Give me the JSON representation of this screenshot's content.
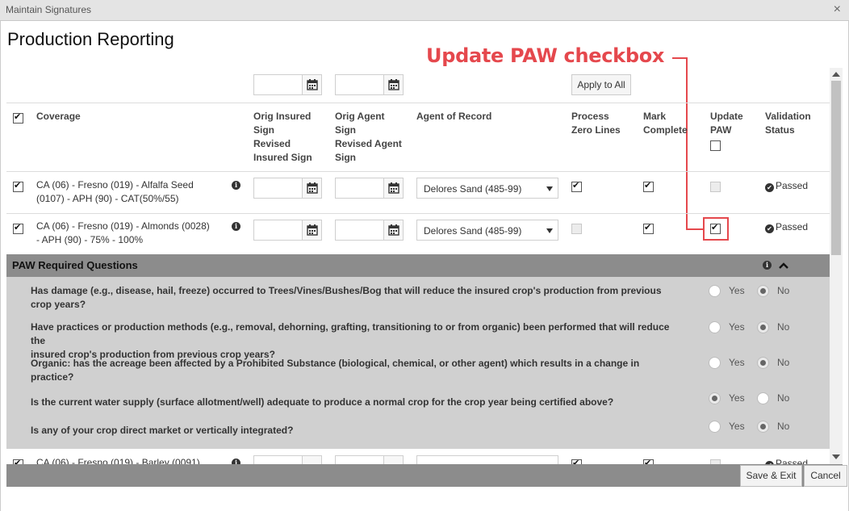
{
  "window": {
    "title": "Maintain Signatures",
    "close_glyph": "×"
  },
  "page_title": "Production Reporting",
  "annotation": {
    "text": "Update PAW checkbox",
    "color": "#e5484d"
  },
  "toolbar": {
    "apply_label": "Apply to All"
  },
  "columns": {
    "coverage": "Coverage",
    "orig_insured": [
      "Orig Insured",
      "Sign",
      "Revised",
      "Insured Sign"
    ],
    "orig_agent": [
      "Orig Agent",
      "Sign",
      "Revised Agent",
      "Sign"
    ],
    "agent_of_record": "Agent of Record",
    "process_zero": [
      "Process",
      "Zero Lines"
    ],
    "mark_complete": [
      "Mark",
      "Complete"
    ],
    "update_paw": [
      "Update",
      "PAW"
    ],
    "validation": [
      "Validation",
      "Status"
    ]
  },
  "header_select_all_checked": true,
  "rows": [
    {
      "checked": true,
      "coverage": [
        "CA (06) - Fresno (019) - Alfalfa Seed",
        "(0107) - APH (90) - CAT(50%/55)"
      ],
      "agent": "Delores Sand (485-99)",
      "process_zero": true,
      "process_zero_disabled": false,
      "mark_complete": true,
      "update_paw": false,
      "update_paw_disabled": true,
      "status": "Passed"
    },
    {
      "checked": true,
      "coverage": [
        "CA (06) - Fresno (019) - Almonds (0028)",
        "- APH (90) - 75% - 100%"
      ],
      "agent": "Delores Sand (485-99)",
      "process_zero": false,
      "process_zero_disabled": true,
      "mark_complete": true,
      "update_paw": true,
      "update_paw_disabled": false,
      "status": "Passed"
    },
    {
      "coverage": [
        "CA (06) - Fresno (019) - Barley (0091)"
      ],
      "status": "Passed"
    }
  ],
  "paw": {
    "title": "PAW Required Questions",
    "yes_label": "Yes",
    "no_label": "No",
    "questions": [
      {
        "text": [
          "Has damage (e.g., disease, hail, freeze) occurred to Trees/Vines/Bushes/Bog that will reduce the insured crop's production from previous",
          "crop years?"
        ],
        "answer": "No"
      },
      {
        "text": [
          "Have practices or production methods (e.g., removal, dehorning, grafting, transitioning to or from organic) been performed that will reduce the",
          "insured crop's production from previous crop years?"
        ],
        "answer": "No"
      },
      {
        "text": [
          "Organic: has the acreage been affected by a Prohibited Substance (biological, chemical, or other agent) which results in a change in",
          "practice?"
        ],
        "answer": "No"
      },
      {
        "text": [
          "Is the current water supply (surface allotment/well) adequate to produce a normal crop for the crop year being certified above?"
        ],
        "answer": "Yes"
      },
      {
        "text": [
          "Is any of your crop direct market or vertically integrated?"
        ],
        "answer": "No"
      }
    ]
  },
  "footer": {
    "save_exit": "Save & Exit",
    "cancel": "Cancel"
  }
}
